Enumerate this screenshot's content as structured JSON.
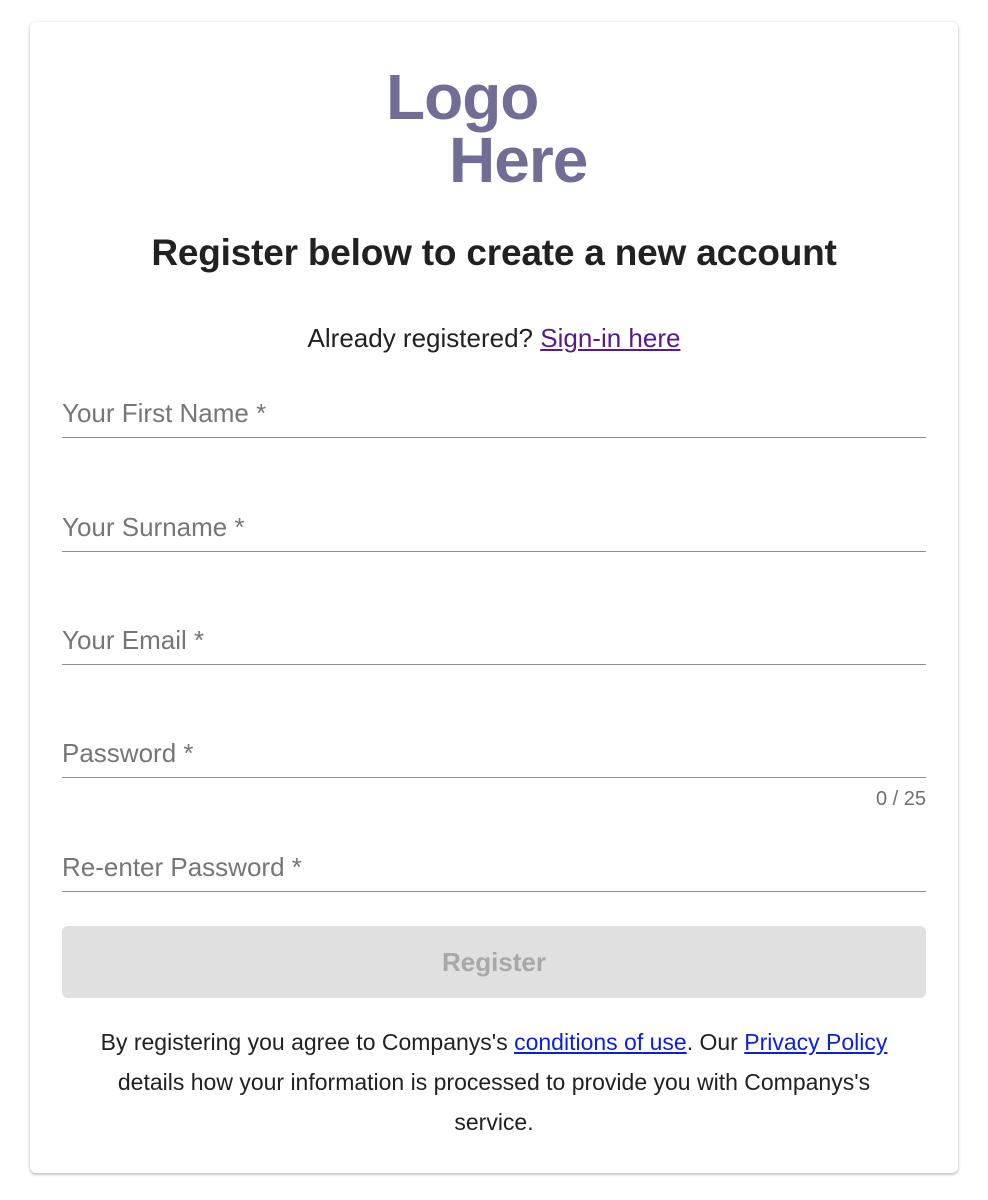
{
  "logo": {
    "line1": "Logo",
    "line2": "Here",
    "color": "#726d95"
  },
  "heading": "Register below to create a new account",
  "signin": {
    "prompt": "Already registered?",
    "link": "Sign-in here"
  },
  "form": {
    "first_name": {
      "placeholder": "Your First Name *",
      "value": ""
    },
    "surname": {
      "placeholder": "Your Surname *",
      "value": ""
    },
    "email": {
      "placeholder": "Your Email *",
      "value": ""
    },
    "password": {
      "placeholder": "Password *",
      "value": "",
      "counter": "0 / 25"
    },
    "confirm_password": {
      "placeholder": "Re-enter Password *",
      "value": ""
    },
    "submit_label": "Register"
  },
  "terms": {
    "part1": "By registering you agree to Companys's ",
    "conditions_link": "conditions of use",
    "part2": ". Our ",
    "privacy_link": "Privacy Policy",
    "part3": " details how your information is processed to provide you with Companys's service."
  }
}
